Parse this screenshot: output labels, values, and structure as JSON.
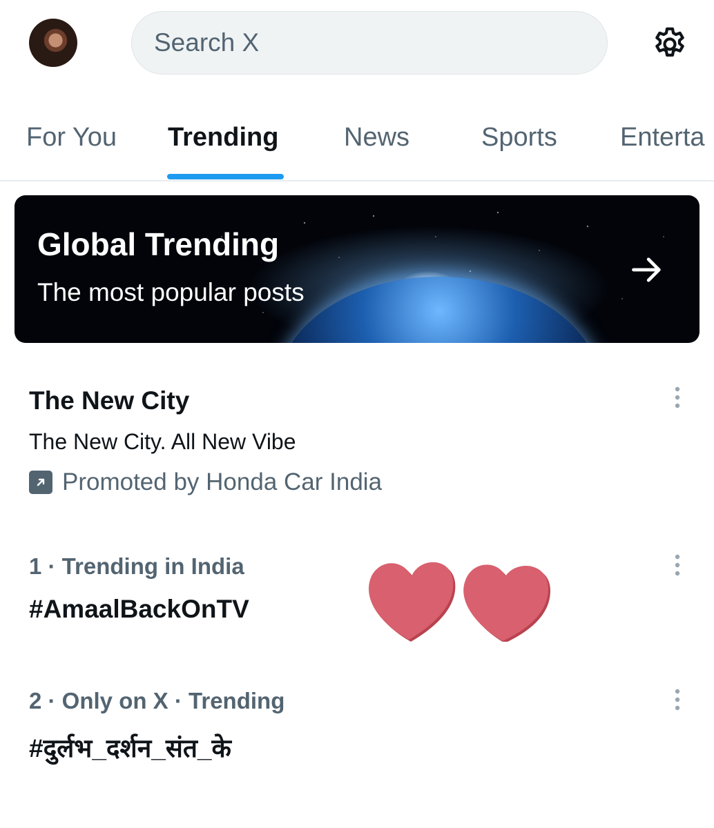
{
  "header": {
    "search_placeholder": "Search X"
  },
  "tabs": [
    {
      "label": "For You",
      "active": false
    },
    {
      "label": "Trending",
      "active": true
    },
    {
      "label": "News",
      "active": false
    },
    {
      "label": "Sports",
      "active": false
    },
    {
      "label": "Enterta",
      "active": false
    }
  ],
  "banner": {
    "title": "Global Trending",
    "subtitle": "The most popular posts"
  },
  "promoted": {
    "title": "The New City",
    "description": "The New City. All New Vibe",
    "promoted_by": "Promoted by Honda Car India"
  },
  "trends": [
    {
      "meta": "1 · Trending in India",
      "tag": "#AmaalBackOnTV"
    },
    {
      "meta": "2 · Only on X · Trending",
      "tag": "#दुर्लभ_दर्शन_संत_के"
    }
  ],
  "icons": {
    "settings": "gear-icon",
    "banner_arrow": "arrow-right-icon",
    "promoted": "promoted-arrow-icon",
    "more": "more-vertical-icon",
    "overlay": "heart-icon"
  },
  "colors": {
    "accent": "#1d9bf0",
    "secondary_text": "#536471",
    "heart": "#d9606e"
  }
}
